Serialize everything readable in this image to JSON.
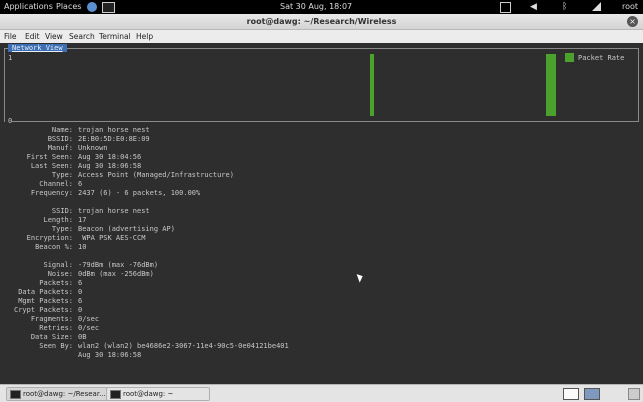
{
  "topbar": {
    "applications": "Applications",
    "places": "Places",
    "clock": "Sat 30 Aug, 18:07",
    "user": "root"
  },
  "window": {
    "title": "root@dawg: ~/Research/Wireless",
    "close_glyph": "×"
  },
  "menu": [
    "File",
    "Edit",
    "View",
    "Search",
    "Terminal",
    "Help"
  ],
  "network_view": {
    "tab_label": "Network View",
    "y_max_label": "1",
    "y_min_label": "0",
    "legend": "Packet Rate",
    "bar_color": "#4aa22d",
    "bars": [
      1,
      1,
      1
    ]
  },
  "details": [
    {
      "key": "Name:",
      "value": "trojan horse nest"
    },
    {
      "key": "BSSID:",
      "value": "2E:B0:5D:E0:8E:09"
    },
    {
      "key": "Manuf:",
      "value": "Unknown"
    },
    {
      "key": "First Seen:",
      "value": "Aug 30 18:04:56"
    },
    {
      "key": "Last Seen:",
      "value": "Aug 30 18:06:58"
    },
    {
      "key": "Type:",
      "value": "Access Point (Managed/Infrastructure)"
    },
    {
      "key": "Channel:",
      "value": "6"
    },
    {
      "key": "Frequency:",
      "value": "2437 (6) - 6 packets, 100.00%"
    },
    {
      "key": "",
      "value": ""
    },
    {
      "key": "SSID:",
      "value": "trojan horse nest"
    },
    {
      "key": "Length:",
      "value": "17"
    },
    {
      "key": "Type:",
      "value": "Beacon (advertising AP)"
    },
    {
      "key": "Encryption:",
      "value": " WPA PSK AES-CCM"
    },
    {
      "key": "Beacon %:",
      "value": "10"
    },
    {
      "key": "",
      "value": ""
    },
    {
      "key": "Signal:",
      "value": "-79dBm (max -76dBm)"
    },
    {
      "key": "Noise:",
      "value": "0dBm (max -256dBm)"
    },
    {
      "key": "Packets:",
      "value": "6"
    },
    {
      "key": "Data Packets:",
      "value": "0"
    },
    {
      "key": "Mgmt Packets:",
      "value": "6"
    },
    {
      "key": "Crypt Packets:",
      "value": "0"
    },
    {
      "key": "Fragments:",
      "value": "0/sec"
    },
    {
      "key": "Retries:",
      "value": "0/sec"
    },
    {
      "key": "Data Size:",
      "value": "0B"
    },
    {
      "key": "Seen By:",
      "value": "wlan2 (wlan2) be4686e2-3067-11e4-90c5-0e04121be401"
    },
    {
      "key": "",
      "value": "Aug 30 18:06:58"
    }
  ],
  "taskbar": {
    "tasks": [
      "root@dawg: ~/Resear...",
      "root@dawg: ~"
    ]
  }
}
